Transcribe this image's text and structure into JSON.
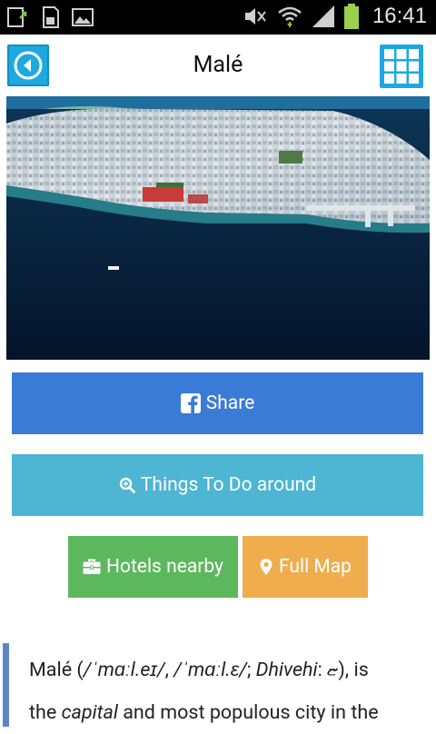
{
  "status_bar": {
    "time": "16:41",
    "icons": [
      "upload-icon",
      "sd-card-icon",
      "image-icon",
      "mute-icon",
      "wifi-icon",
      "signal-icon",
      "battery-icon"
    ]
  },
  "header": {
    "title": "Malé",
    "back_icon": "back-arrow-icon",
    "menu_icon": "grid-icon",
    "accent": "#1da9e0"
  },
  "actions": {
    "share_label": "Share",
    "things_label": "Things To Do around",
    "hotels_label": "Hotels nearby",
    "map_label": "Full Map"
  },
  "colors": {
    "share": "#3a7bd5",
    "things": "#4eb5d3",
    "hotels": "#5cb85c",
    "map": "#f0ad4e",
    "quote_bar": "#5e86c6"
  },
  "article": {
    "line1_a": "Malé (",
    "line1_pron1": "/ˈmɑːl.eɪ/",
    "line1_sep": ", ",
    "line1_pron2": "/ˈmɑːl.ɛ/",
    "line1_b": "; ",
    "line1_lang": "Dhivehi",
    "line1_c": ": ޏ), is",
    "line2_a": "the ",
    "line2_capital": "capital",
    "line2_b": " and most populous city in the"
  }
}
